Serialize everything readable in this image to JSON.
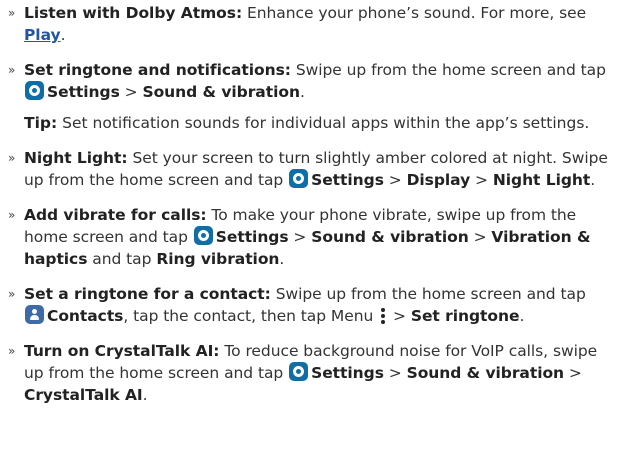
{
  "bullet": "»",
  "items": [
    {
      "title": "Listen with Dolby Atmos:",
      "text1": " Enhance your phone’s sound. For more, see ",
      "link": "Play",
      "text2": "."
    },
    {
      "title": "Set ringtone and notifications:",
      "text1": " Swipe up from the home screen and tap ",
      "settings": "Settings",
      "sep1": " > ",
      "path1": "Sound & vibration",
      "end": "."
    },
    {
      "title": "Night Light:",
      "text1": " Set your screen to turn slightly amber colored at night. Swipe up from the home screen and tap ",
      "settings": "Settings",
      "sep1": " > ",
      "path1": "Display",
      "sep2": " > ",
      "path2": "Night Light",
      "end": "."
    },
    {
      "title": "Add vibrate for calls:",
      "text1": " To make your phone vibrate, swipe up from the home screen and tap ",
      "settings": "Settings",
      "sep1": " > ",
      "path1": "Sound & vibration",
      "sep2": " > ",
      "path2": "Vibration & haptics",
      "text2": " and tap ",
      "path3": "Ring vibration",
      "end": "."
    },
    {
      "title": "Set a ringtone for a contact:",
      "text1": " Swipe up from the home screen and tap ",
      "contacts": "Contacts",
      "text2": ", tap the contact, then tap Menu ",
      "sep1": " > ",
      "path1": "Set ringtone",
      "end": "."
    },
    {
      "title": "Turn on CrystalTalk AI:",
      "text1": " To reduce background noise for VoIP calls, swipe up from the home screen and tap ",
      "settings": "Settings",
      "sep1": " > ",
      "path1": "Sound & vibration",
      "sep2": " > ",
      "path2": "CrystalTalk AI",
      "end": "."
    }
  ],
  "tip": {
    "label": "Tip:",
    "text": " Set notification sounds for individual apps within the app’s settings."
  },
  "icons": {
    "settings": "settings-gear-icon",
    "contacts": "contacts-person-icon",
    "menu": "menu-dots-icon"
  },
  "colors": {
    "link": "#23569c",
    "settings_icon": "#0d6fa6",
    "contacts_icon": "#3f6aa8"
  }
}
